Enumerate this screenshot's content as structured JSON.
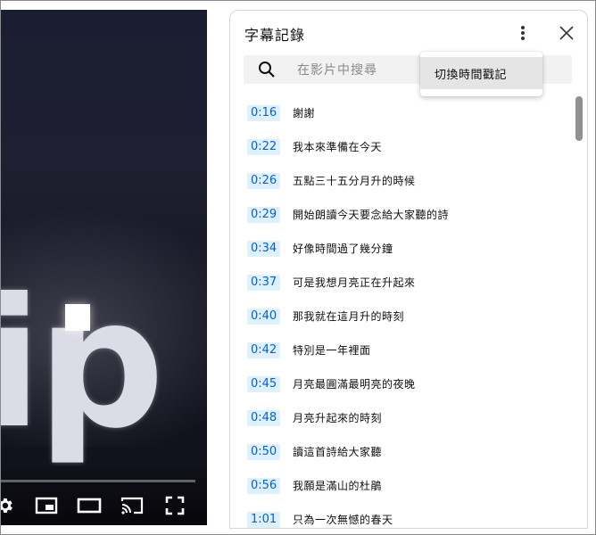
{
  "panel": {
    "title": "字幕記錄",
    "more_icon": "more-vert-icon",
    "close_icon": "close-icon"
  },
  "search": {
    "placeholder": "在影片中搜尋",
    "icon": "search-icon"
  },
  "menu": {
    "item_label": "切換時間戳記"
  },
  "player": {
    "controls": [
      "settings-icon",
      "miniplayer-icon",
      "theater-mode-icon",
      "cast-icon",
      "fullscreen-icon"
    ]
  },
  "segments": [
    {
      "time": "0:16",
      "text": "謝謝"
    },
    {
      "time": "0:22",
      "text": "我本來準備在今天"
    },
    {
      "time": "0:26",
      "text": "五點三十五分月升的時候"
    },
    {
      "time": "0:29",
      "text": "開始朗讀今天要念給大家聽的詩"
    },
    {
      "time": "0:34",
      "text": "好像時間過了幾分鐘"
    },
    {
      "time": "0:37",
      "text": "可是我想月亮正在升起來"
    },
    {
      "time": "0:40",
      "text": "那我就在這月升的時刻"
    },
    {
      "time": "0:42",
      "text": "特別是一年裡面"
    },
    {
      "time": "0:45",
      "text": "月亮最圓滿最明亮的夜晚"
    },
    {
      "time": "0:48",
      "text": "月亮升起來的時刻"
    },
    {
      "time": "0:50",
      "text": "讀這首詩給大家聽"
    },
    {
      "time": "0:56",
      "text": "我願是滿山的杜鵑"
    },
    {
      "time": "1:01",
      "text": "只為一次無憾的春天"
    }
  ],
  "colors": {
    "timestamp_bg": "#def1ff",
    "timestamp_text": "#065fd4"
  }
}
